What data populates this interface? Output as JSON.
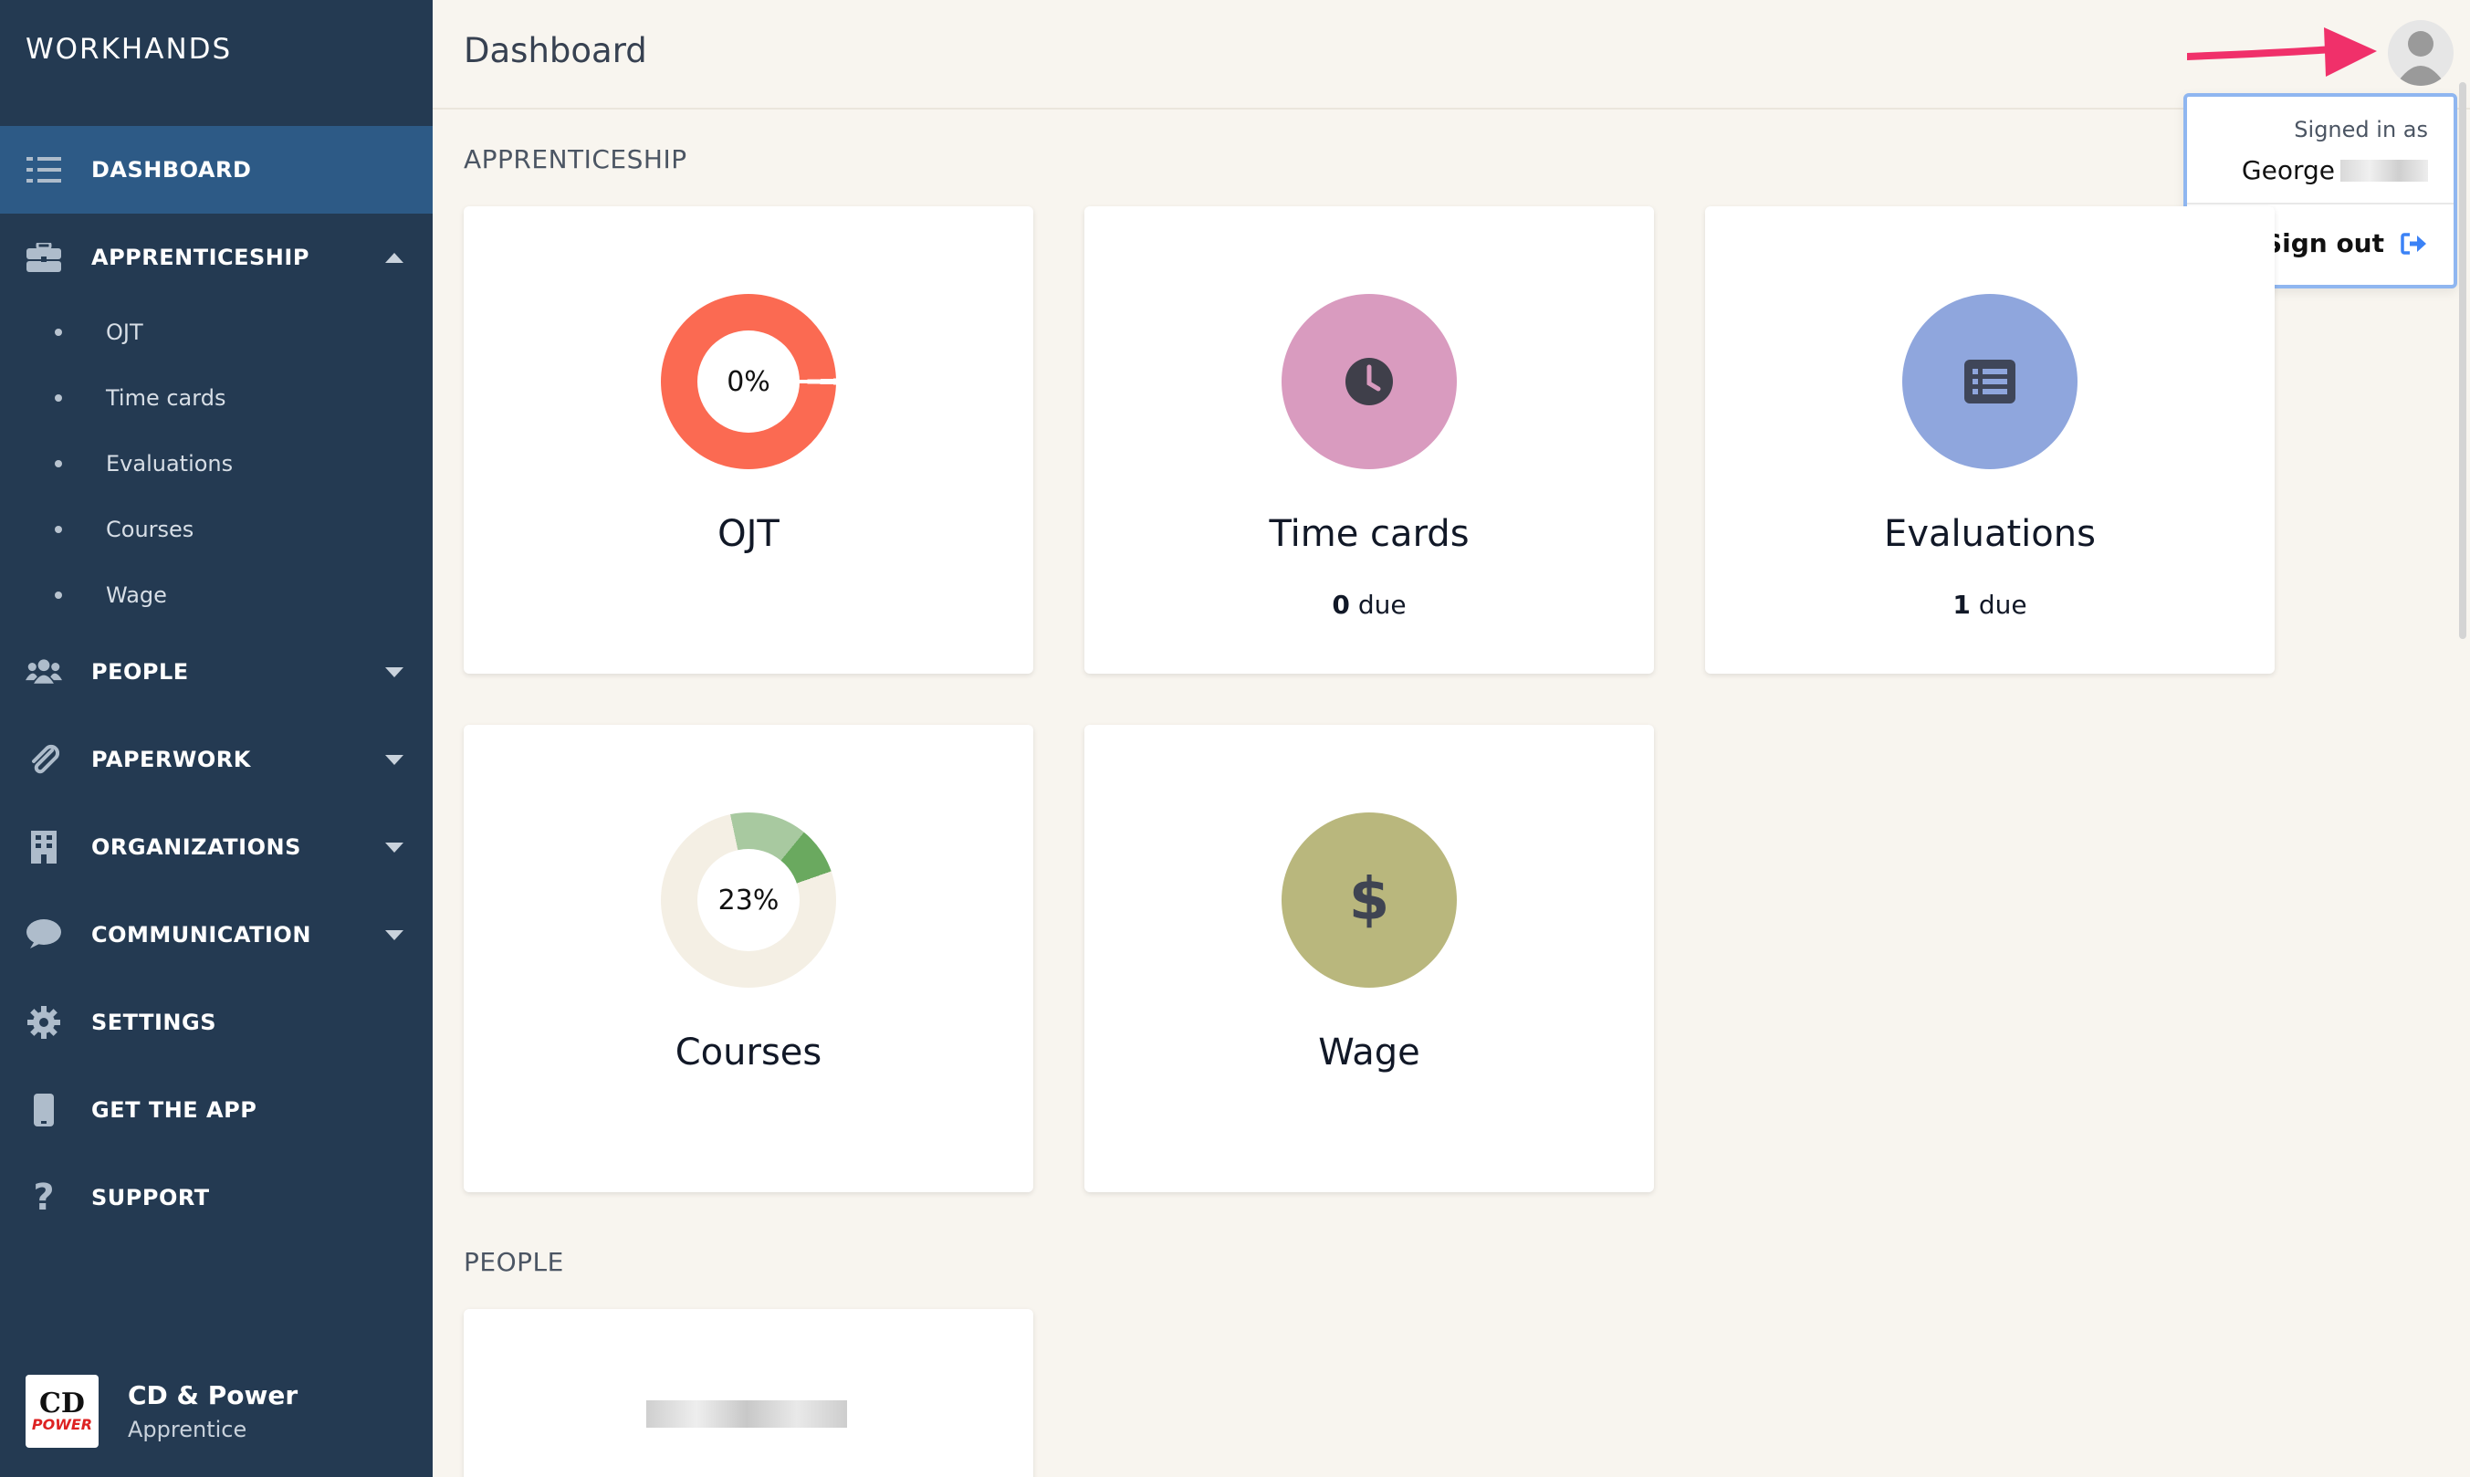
{
  "brand": "WORKHANDS",
  "header": {
    "title": "Dashboard"
  },
  "sidebar": {
    "items": [
      {
        "label": "DASHBOARD",
        "icon": "list-check-icon",
        "active": true
      },
      {
        "label": "APPRENTICESHIP",
        "icon": "briefcase-icon",
        "expanded": true
      },
      {
        "label": "PEOPLE",
        "icon": "users-icon"
      },
      {
        "label": "PAPERWORK",
        "icon": "paperclip-icon"
      },
      {
        "label": "ORGANIZATIONS",
        "icon": "building-icon"
      },
      {
        "label": "COMMUNICATION",
        "icon": "chat-bubble-icon"
      },
      {
        "label": "SETTINGS",
        "icon": "gear-icon"
      },
      {
        "label": "GET THE APP",
        "icon": "mobile-phone-icon"
      },
      {
        "label": "SUPPORT",
        "icon": "question-icon"
      }
    ],
    "subitems": [
      "OJT",
      "Time cards",
      "Evaluations",
      "Courses",
      "Wage"
    ]
  },
  "org": {
    "name": "CD & Power",
    "role": "Apprentice",
    "logo_text_top": "CD",
    "logo_text_bottom": "POWER"
  },
  "user_menu": {
    "signed_in_as": "Signed in as",
    "user_name": "George",
    "sign_out": "Sign out"
  },
  "sections": {
    "apprenticeship": "APPRENTICESHIP",
    "people": "PEOPLE"
  },
  "cards": {
    "ojt": {
      "title": "OJT",
      "percent_label": "0%",
      "percent": 0,
      "color": "#fb6a52"
    },
    "timecards": {
      "title": "Time cards",
      "due_count": "0",
      "due_label": "due",
      "color": "#d99bbf"
    },
    "evaluations": {
      "title": "Evaluations",
      "due_count": "1",
      "due_label": "due",
      "color": "#8fa6dd"
    },
    "courses": {
      "title": "Courses",
      "percent_label": "23%",
      "percent": 23,
      "color": "#a8c9a0"
    },
    "wage": {
      "title": "Wage",
      "icon_glyph": "$",
      "color": "#b9b77d"
    }
  }
}
